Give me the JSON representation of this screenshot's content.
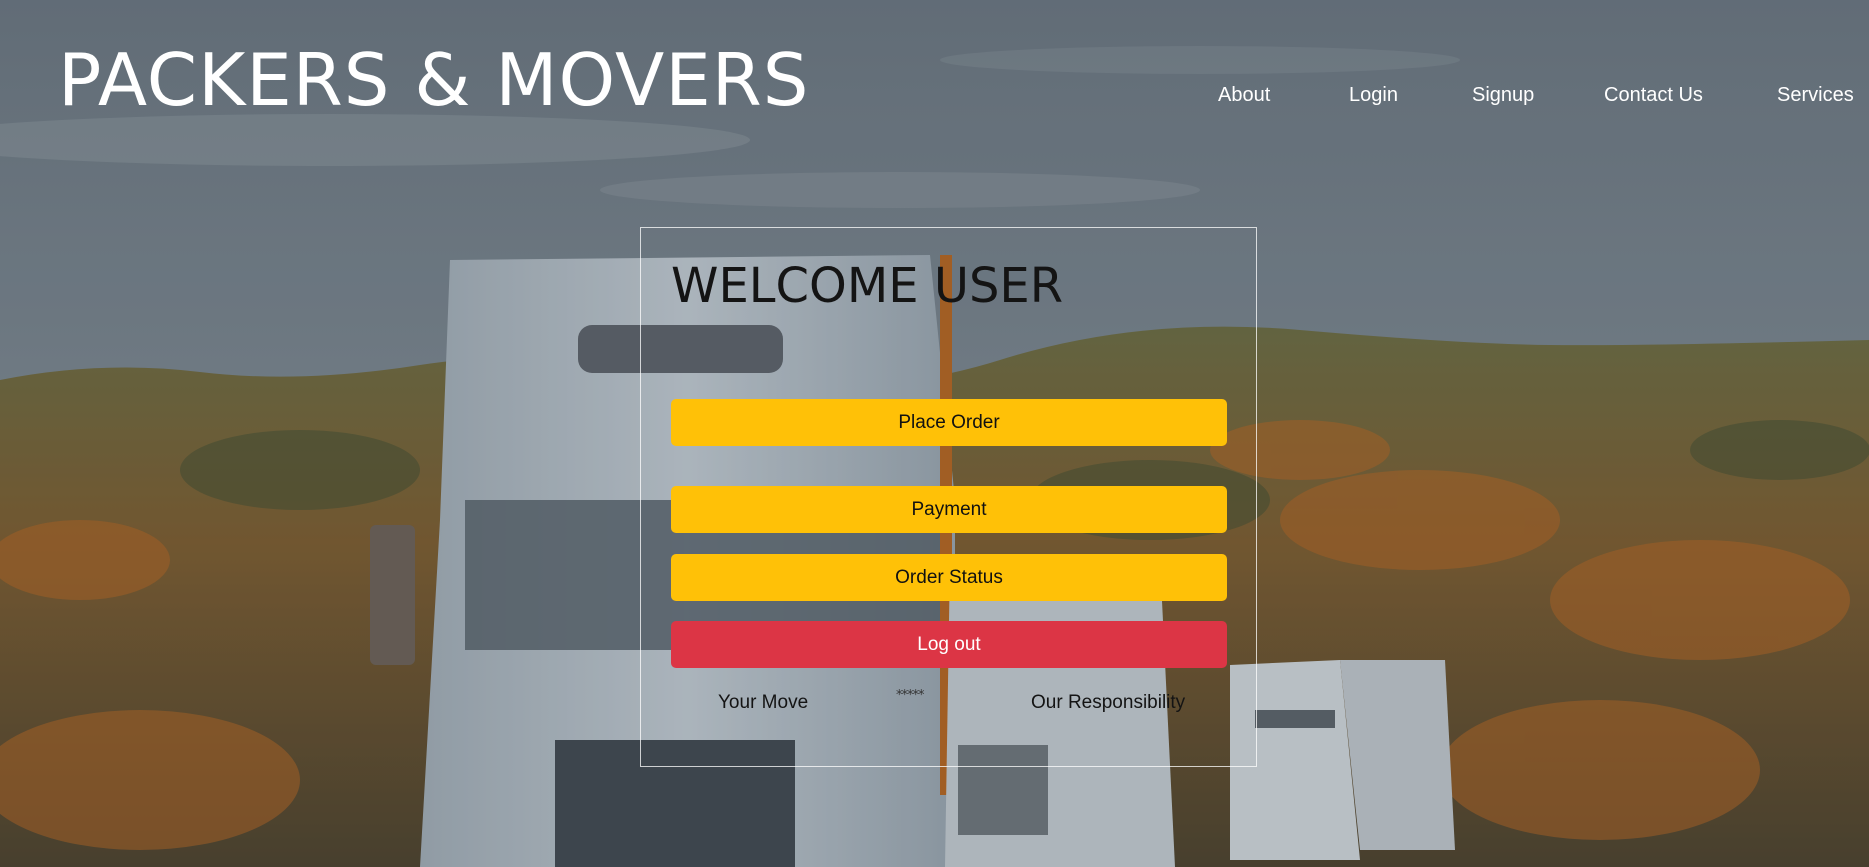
{
  "brand": {
    "title": "PACKERS & MOVERS"
  },
  "nav": {
    "items": [
      {
        "label": "About"
      },
      {
        "label": "Login"
      },
      {
        "label": "Signup"
      },
      {
        "label": "Contact Us"
      },
      {
        "label": "Services"
      }
    ]
  },
  "card": {
    "heading": "WELCOME USER",
    "buttons": {
      "place_order": "Place Order",
      "payment": "Payment",
      "order_status": "Order Status",
      "logout": "Log out"
    },
    "footer": {
      "left_text": "Your Move",
      "stars": "*****",
      "right_text": "Our Responsibility"
    }
  },
  "colors": {
    "primary_button": "#ffc107",
    "danger_button": "#dc3545",
    "header_text": "#ffffff"
  },
  "background": {
    "icon": "truck-forest-photo"
  }
}
